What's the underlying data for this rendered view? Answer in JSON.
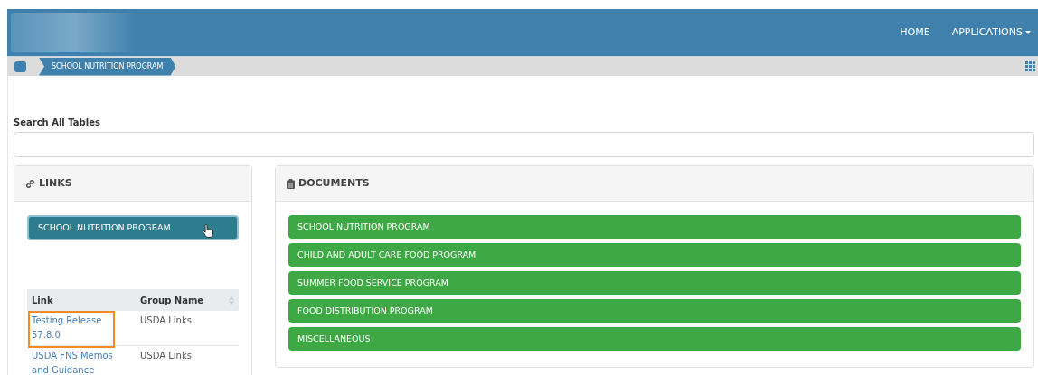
{
  "nav": [
    {
      "label": "HOME",
      "dropdown": false
    },
    {
      "label": "APPLICATIONS",
      "dropdown": true
    }
  ],
  "breadcrumb": [
    {
      "label": "SCHOOL NUTRITION PROGRAM"
    }
  ],
  "search": {
    "label": "Search All Tables"
  },
  "links_panel": {
    "title": "LINKS",
    "button": "SCHOOL NUTRITION PROGRAM",
    "table": {
      "columns": [
        {
          "label": "Link",
          "sortable": false
        },
        {
          "label": "Group Name",
          "sortable": true
        }
      ],
      "rows": [
        {
          "link": "Testing Release 57.8.0",
          "group": "USDA Links",
          "highlighted": true
        },
        {
          "link": "USDA FNS Memos and Guidance",
          "group": "USDA Links",
          "highlighted": false
        }
      ]
    }
  },
  "documents_panel": {
    "title": "DOCUMENTS",
    "items": [
      "SCHOOL NUTRITION PROGRAM",
      "CHILD AND ADULT CARE FOOD PROGRAM",
      "SUMMER FOOD SERVICE PROGRAM",
      "FOOD DISTRIBUTION PROGRAM",
      "MISCELLANEOUS"
    ]
  }
}
